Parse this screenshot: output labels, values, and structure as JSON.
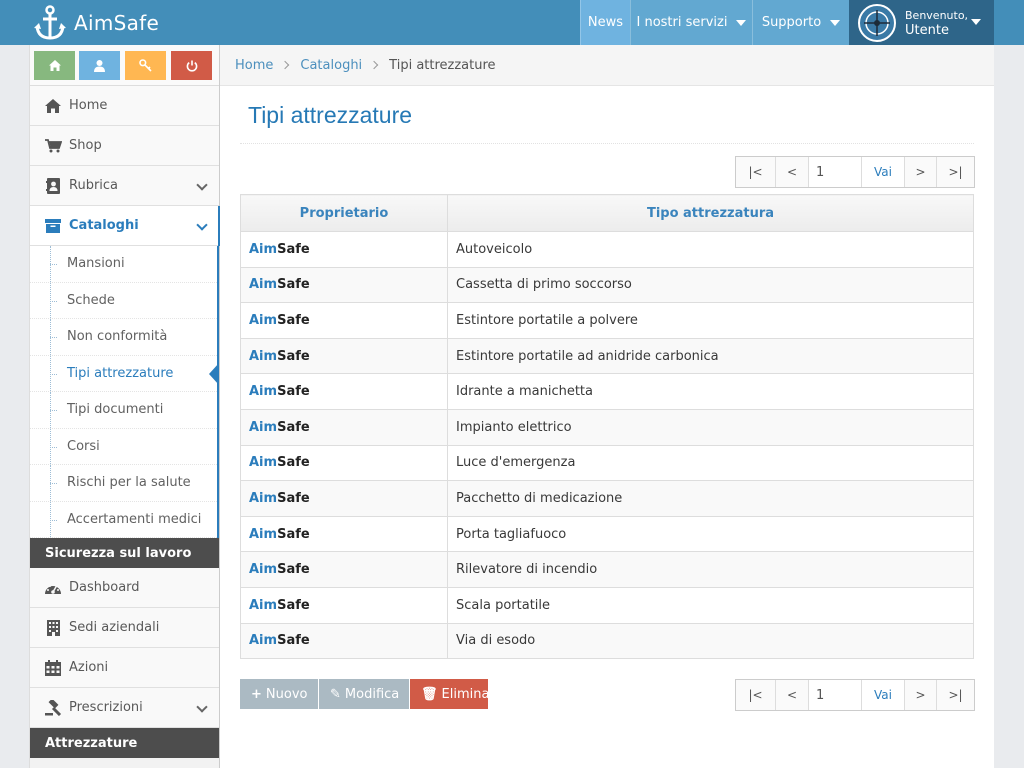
{
  "brand": {
    "name": "AimSafe"
  },
  "topnav": {
    "news": "News",
    "services": "I nostri servizi",
    "support": "Supporto",
    "user": {
      "welcome": "Benvenuto,",
      "name": "Utente"
    }
  },
  "sidebar": {
    "menu": [
      {
        "label": "Home",
        "icon": "home-icon"
      },
      {
        "label": "Shop",
        "icon": "cart-icon"
      },
      {
        "label": "Rubrica",
        "icon": "address-book-icon"
      },
      {
        "label": "Cataloghi",
        "icon": "catalog-icon"
      }
    ],
    "cataloghi_sub": [
      "Mansioni",
      "Schede",
      "Non conformità",
      "Tipi attrezzature",
      "Tipi documenti",
      "Corsi",
      "Rischi per la salute",
      "Accertamenti medici"
    ],
    "section_sicurezza": "Sicurezza sul lavoro",
    "sicurezza_menu": [
      {
        "label": "Dashboard",
        "icon": "dashboard-icon"
      },
      {
        "label": "Sedi aziendali",
        "icon": "building-icon"
      },
      {
        "label": "Azioni",
        "icon": "calendar-icon"
      },
      {
        "label": "Prescrizioni",
        "icon": "gavel-icon"
      }
    ],
    "section_attrezzature": "Attrezzature"
  },
  "breadcrumb": {
    "home": "Home",
    "catalogs": "Cataloghi",
    "current": "Tipi attrezzature"
  },
  "page": {
    "title": "Tipi attrezzature"
  },
  "pager": {
    "first": "|<",
    "prev": "<",
    "page": "1",
    "go": "Vai",
    "next": ">",
    "last": ">|"
  },
  "table": {
    "headers": [
      "Proprietario",
      "Tipo attrezzatura"
    ],
    "owner_a": "Aim",
    "owner_b": "Safe",
    "rows": [
      "Autoveicolo",
      "Cassetta di primo soccorso",
      "Estintore portatile a polvere",
      "Estintore portatile ad anidride carbonica",
      "Idrante a manichetta",
      "Impianto elettrico",
      "Luce d'emergenza",
      "Pacchetto di medicazione",
      "Porta tagliafuoco",
      "Rilevatore di incendio",
      "Scala portatile",
      "Via di esodo"
    ]
  },
  "actions": {
    "new": "Nuovo",
    "edit": "Modifica",
    "delete": "Elimina"
  },
  "colors": {
    "topbar": "#438eb9",
    "accent": "#2b7dbc",
    "danger": "#d15b47",
    "disabled": "#abbac3"
  }
}
